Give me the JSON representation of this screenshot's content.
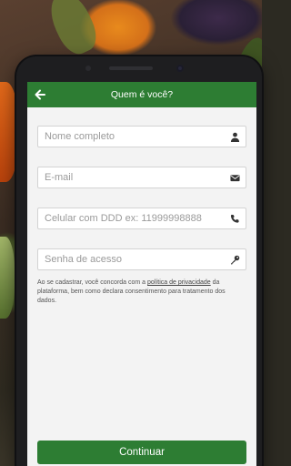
{
  "header": {
    "title": "Quem é você?"
  },
  "form": {
    "name_placeholder": "Nome completo",
    "email_placeholder": "E-mail",
    "phone_placeholder": "Celular com DDD ex: 11999998888",
    "password_placeholder": "Senha de acesso"
  },
  "consent": {
    "before": "Ao se cadastrar, você concorda com a ",
    "link": "política de privacidade",
    "after": " da plataforma, bem como declara consentimento para tratamento dos dados."
  },
  "footer": {
    "continue_label": "Continuar"
  },
  "theme": {
    "primary": "#2d7d33",
    "screen_bg": "#f3f3f3"
  },
  "icons": [
    "back-arrow-icon",
    "person-icon",
    "envelope-icon",
    "phone-icon",
    "key-icon"
  ]
}
